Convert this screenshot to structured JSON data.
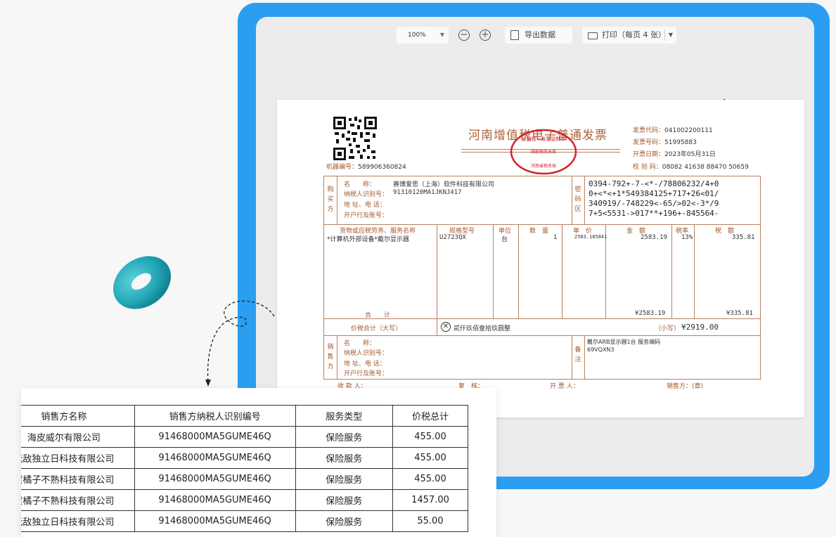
{
  "toolbar": {
    "zoom": "100%",
    "zoom_out_symbol": "−",
    "zoom_in_symbol": "+",
    "export_label": "导出数据",
    "print_label": "打印（每页 4 张）"
  },
  "invoice": {
    "title": "河南增值税电子普通发票",
    "machine_label": "机器编号：",
    "machine_no": "589906360824",
    "code_label": "发票代码：",
    "code": "041002200111",
    "number_label": "发票号码：",
    "number": "51995883",
    "date_label": "开票日期：",
    "date": "2023年05月31日",
    "check_label": "校 验 码：",
    "check_code": "08082 41638 88470 50659",
    "seal_text_top": "全国统一发票监制章",
    "seal_text_mid": "国家税务总局",
    "seal_text_bottom": "河南省税务局",
    "buyer_section": "购买方",
    "name_label": "名　　称：",
    "taxid_label": "纳税人识别号：",
    "addr_label": "地 址、电 话：",
    "bank_label": "开户行及账号：",
    "buyer_name": "赛博爱思（上海）软件科技有限公司",
    "buyer_taxid": "91310120MA1JKNJ417",
    "cipher_section": "密码区",
    "cipher_lines": [
      "0394-792+-7-<*-/78806232/4+0",
      "0+<*<+1*549384125+717+26<01/",
      "340919/-748229<-65/>02<-3*/9",
      "7+5<5531->017**+196+-845564-"
    ],
    "col_goods": "货物或应税劳务、服务名称",
    "col_spec": "规格型号",
    "col_unit": "单位",
    "col_qty": "数　量",
    "col_price": "单　价",
    "col_amount": "金　额",
    "col_rate": "税率",
    "col_tax": "税　额",
    "item_name": "*计算机外部设备*戴尔显示器",
    "item_spec": "U2723QX",
    "item_unit": "台",
    "item_qty": "1",
    "item_price": "2583.185841",
    "item_amount": "2583.19",
    "item_rate": "13%",
    "item_tax": "335.81",
    "total_label": "合　　计",
    "total_amount": "¥2583.19",
    "total_tax": "¥335.81",
    "sum_label": "价税合计（大写）",
    "sum_upper": "贰仟玖佰壹拾玖圆整",
    "sum_small_label": "（小写）",
    "sum_small": "¥2919.00",
    "seller_section": "销售方",
    "remark_section": "备注",
    "remark_line1": "戴尔ARB显示器1台 服务编码",
    "remark_line2": "69VQXN3",
    "payee_label": "收 款 人：",
    "reviewer_label": "复　核：",
    "drawer_label": "开 票 人：",
    "seller_stamp_label": "销售方：(章)"
  },
  "data_table": {
    "headers": [
      "销售方名称",
      "销售方纳税人识别编号",
      "服务类型",
      "价税总计"
    ],
    "rows": [
      [
        "海皮威尔有限公司",
        "91468000MA5GUME46Q",
        "保险服务",
        "455.00"
      ],
      [
        "无敌独立日科技有限公司",
        "91468000MA5GUME46Q",
        "保险服务",
        "455.00"
      ],
      [
        "蜜橘子不熟科技有限公司",
        "91468000MA5GUME46Q",
        "保险服务",
        "455.00"
      ],
      [
        "蜜橘子不熟科技有限公司",
        "91468000MA5GUME46Q",
        "保险服务",
        "1457.00"
      ],
      [
        "无敌独立日科技有限公司",
        "91468000MA5GUME46Q",
        "保险服务",
        "55.00"
      ]
    ]
  },
  "colors": {
    "frame_blue": "#2c9ef1",
    "invoice_brown": "#a3582c",
    "seal_red": "#d0232a",
    "torus_teal": "#22a8b8"
  },
  "icons": [
    "zoom-out-icon",
    "zoom-in-icon",
    "export-icon",
    "printer-icon",
    "cursor-icon",
    "qr-code-icon",
    "circle-x-icon"
  ]
}
